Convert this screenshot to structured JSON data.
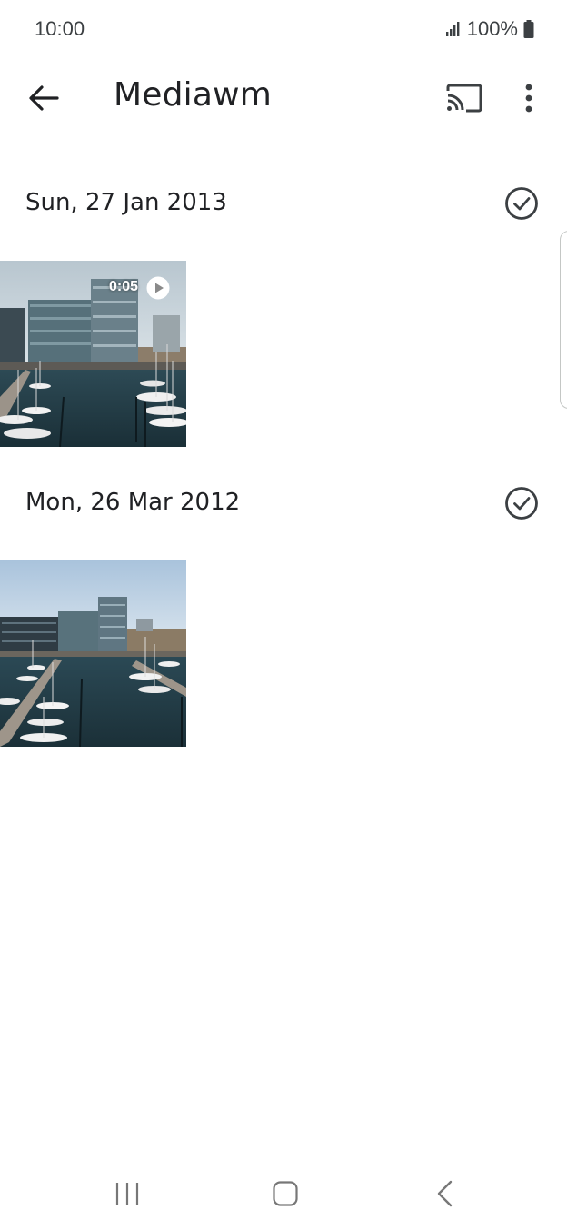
{
  "status_bar": {
    "time": "10:00",
    "battery_text": "100%",
    "icons": [
      "signal-icon",
      "battery-icon"
    ]
  },
  "app_bar": {
    "title": "Mediawm",
    "icons": [
      "back-arrow-icon",
      "cast-icon",
      "more-vert-icon"
    ]
  },
  "sections": [
    {
      "date": "Sun, 27 Jan 2013",
      "items": [
        {
          "type": "video",
          "duration": "0:05",
          "icon": "play-icon"
        }
      ]
    },
    {
      "date": "Mon, 26 Mar 2012",
      "items": [
        {
          "type": "photo"
        }
      ]
    }
  ],
  "nav_bar": {
    "icons": [
      "recents-icon",
      "home-icon",
      "back-icon"
    ]
  },
  "colors": {
    "text_primary": "#202124",
    "icon": "#3c4043",
    "water": "#1f3a44",
    "sky": "#c9d8e4"
  }
}
